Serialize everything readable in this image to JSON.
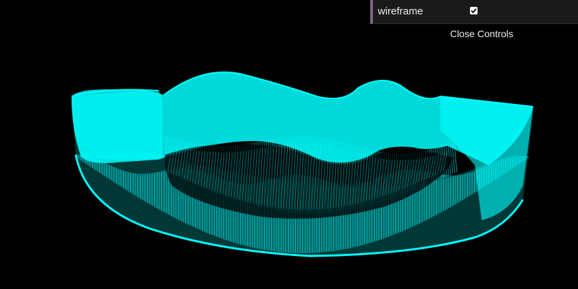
{
  "scene": {
    "mesh_color": "#00ffff",
    "mesh_color_shade": "#00c8c8",
    "background": "#000000",
    "wireframe": true
  },
  "gui": {
    "controls": [
      {
        "label": "wireframe",
        "type": "checkbox",
        "checked": true
      }
    ],
    "close_label": "Close Controls",
    "accent_color": "#806787"
  }
}
